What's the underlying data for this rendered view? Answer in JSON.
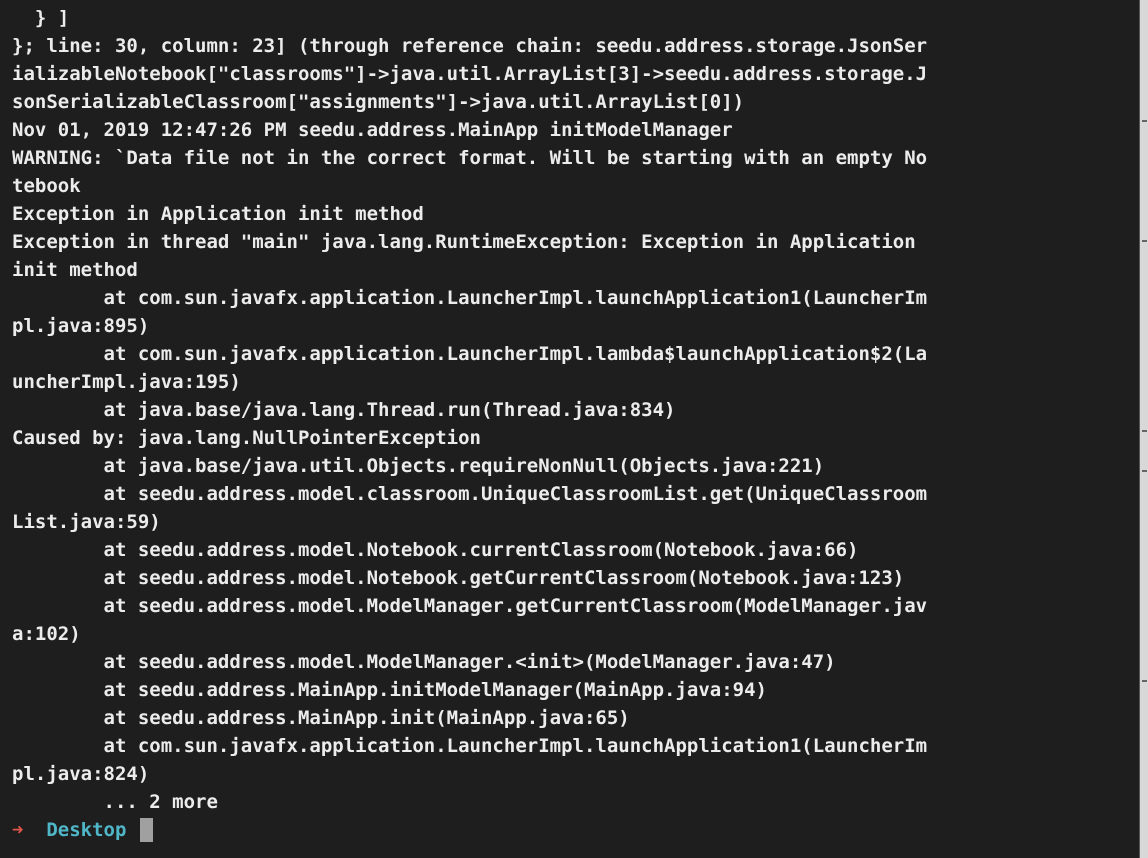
{
  "terminal": {
    "lines": [
      "  } ]",
      "}; line: 30, column: 23] (through reference chain: seedu.address.storage.JsonSer",
      "ializableNotebook[\"classrooms\"]->java.util.ArrayList[3]->seedu.address.storage.J",
      "sonSerializableClassroom[\"assignments\"]->java.util.ArrayList[0])",
      "Nov 01, 2019 12:47:26 PM seedu.address.MainApp initModelManager",
      "WARNING: `Data file not in the correct format. Will be starting with an empty No",
      "tebook",
      "Exception in Application init method",
      "Exception in thread \"main\" java.lang.RuntimeException: Exception in Application",
      "init method",
      "        at com.sun.javafx.application.LauncherImpl.launchApplication1(LauncherIm",
      "pl.java:895)",
      "        at com.sun.javafx.application.LauncherImpl.lambda$launchApplication$2(La",
      "uncherImpl.java:195)",
      "        at java.base/java.lang.Thread.run(Thread.java:834)",
      "Caused by: java.lang.NullPointerException",
      "        at java.base/java.util.Objects.requireNonNull(Objects.java:221)",
      "        at seedu.address.model.classroom.UniqueClassroomList.get(UniqueClassroom",
      "List.java:59)",
      "        at seedu.address.model.Notebook.currentClassroom(Notebook.java:66)",
      "        at seedu.address.model.Notebook.getCurrentClassroom(Notebook.java:123)",
      "        at seedu.address.model.ModelManager.getCurrentClassroom(ModelManager.jav",
      "a:102)",
      "        at seedu.address.model.ModelManager.<init>(ModelManager.java:47)",
      "        at seedu.address.MainApp.initModelManager(MainApp.java:94)",
      "        at seedu.address.MainApp.init(MainApp.java:65)",
      "        at com.sun.javafx.application.LauncherImpl.launchApplication1(LauncherIm",
      "pl.java:824)",
      "        ... 2 more"
    ],
    "prompt": {
      "arrow": "➜",
      "directory": "Desktop"
    },
    "colors": {
      "background": "#1e1e1e",
      "text": "#ececec",
      "prompt_arrow": "#e0574a",
      "prompt_dir": "#4fb7c8",
      "cursor": "#a0a0a0"
    }
  }
}
